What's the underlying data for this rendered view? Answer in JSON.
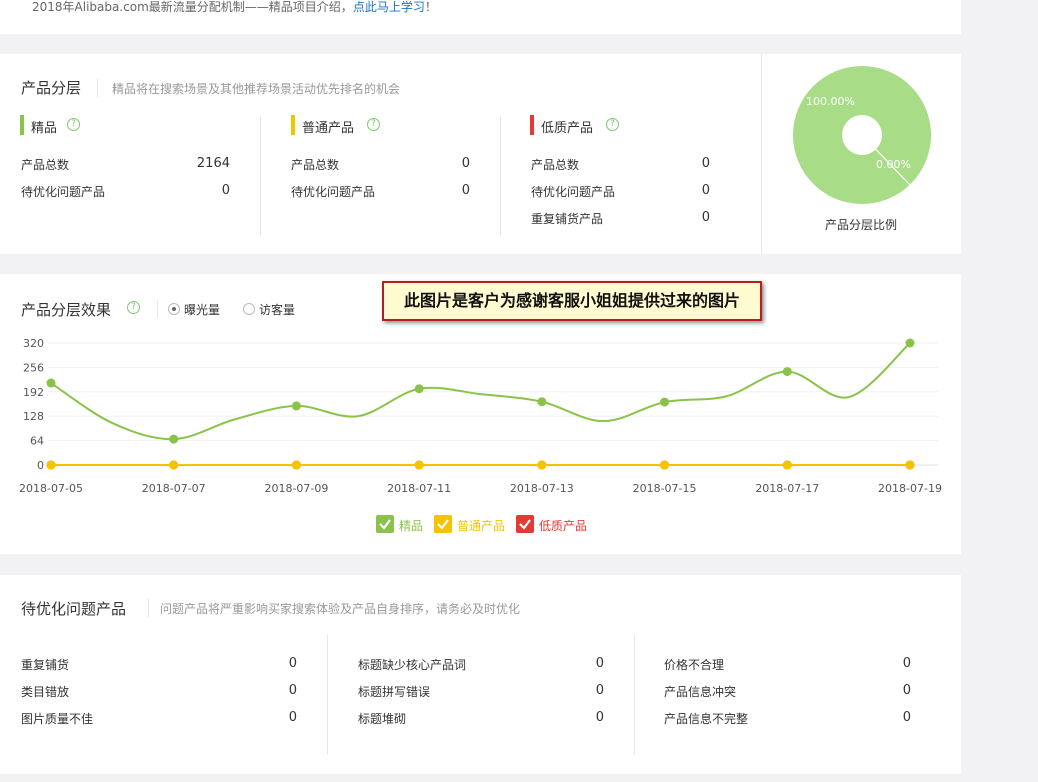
{
  "notice": {
    "text": "2018年Alibaba.com最新流量分配机制——精品项目介绍，",
    "link": "点此马上学习",
    "suffix": "！"
  },
  "tiers": {
    "title": "产品分层",
    "desc": "精品将在搜索场景及其他推荐场景活动优先排名的机会",
    "groups": [
      {
        "name": "精品",
        "color": "#8bc34a",
        "rows": [
          {
            "label": "产品总数",
            "value": "2164"
          },
          {
            "label": "待优化问题产品",
            "value": "0"
          }
        ]
      },
      {
        "name": "普通产品",
        "color": "#f5c400",
        "rows": [
          {
            "label": "产品总数",
            "value": "0"
          },
          {
            "label": "待优化问题产品",
            "value": "0"
          }
        ]
      },
      {
        "name": "低质产品",
        "color": "#e53935",
        "rows": [
          {
            "label": "产品总数",
            "value": "0"
          },
          {
            "label": "待优化问题产品",
            "value": "0"
          },
          {
            "label": "重复铺货产品",
            "value": "0"
          }
        ]
      }
    ],
    "pie": {
      "caption": "产品分层比例",
      "label_main": "100.00%",
      "label_minor": "0.00%",
      "color": "#a8dc86"
    }
  },
  "effect": {
    "title": "产品分层效果",
    "radio_exposure": "曝光量",
    "radio_visitors": "访客量",
    "annotation": "此图片是客户为感谢客服小姐姐提供过来的图片"
  },
  "chart_data": {
    "type": "line",
    "x": [
      "2018-07-05",
      "2018-07-06",
      "2018-07-07",
      "2018-07-08",
      "2018-07-09",
      "2018-07-10",
      "2018-07-11",
      "2018-07-12",
      "2018-07-13",
      "2018-07-14",
      "2018-07-15",
      "2018-07-16",
      "2018-07-17",
      "2018-07-18",
      "2018-07-19"
    ],
    "x_tick_labels": [
      "2018-07-05",
      "2018-07-07",
      "2018-07-09",
      "2018-07-11",
      "2018-07-13",
      "2018-07-15",
      "2018-07-17",
      "2018-07-19"
    ],
    "y_ticks": [
      "0",
      "64",
      "128",
      "192",
      "256",
      "320"
    ],
    "ylim": [
      0,
      320
    ],
    "grid": true,
    "legend_position": "bottom",
    "series": [
      {
        "name": "精品",
        "color": "#8bc34a",
        "values": [
          215,
          110,
          68,
          120,
          155,
          128,
          200,
          186,
          166,
          115,
          165,
          180,
          245,
          178,
          320
        ]
      },
      {
        "name": "普通产品",
        "color": "#f5c400",
        "values": [
          0,
          0,
          0,
          0,
          0,
          0,
          0,
          0,
          0,
          0,
          0,
          0,
          0,
          0,
          0
        ]
      },
      {
        "name": "低质产品",
        "color": "#e53935",
        "values": [
          0,
          0,
          0,
          0,
          0,
          0,
          0,
          0,
          0,
          0,
          0,
          0,
          0,
          0,
          0
        ]
      }
    ]
  },
  "issues": {
    "title": "待优化问题产品",
    "desc": "问题产品将严重影响买家搜索体验及产品自身排序，请务必及时优化",
    "columns": [
      [
        {
          "label": "重复铺货",
          "value": "0"
        },
        {
          "label": "类目错放",
          "value": "0"
        },
        {
          "label": "图片质量不佳",
          "value": "0"
        }
      ],
      [
        {
          "label": "标题缺少核心产品词",
          "value": "0"
        },
        {
          "label": "标题拼写错误",
          "value": "0"
        },
        {
          "label": "标题堆砌",
          "value": "0"
        }
      ],
      [
        {
          "label": "价格不合理",
          "value": "0"
        },
        {
          "label": "产品信息冲突",
          "value": "0"
        },
        {
          "label": "产品信息不完整",
          "value": "0"
        }
      ]
    ]
  }
}
